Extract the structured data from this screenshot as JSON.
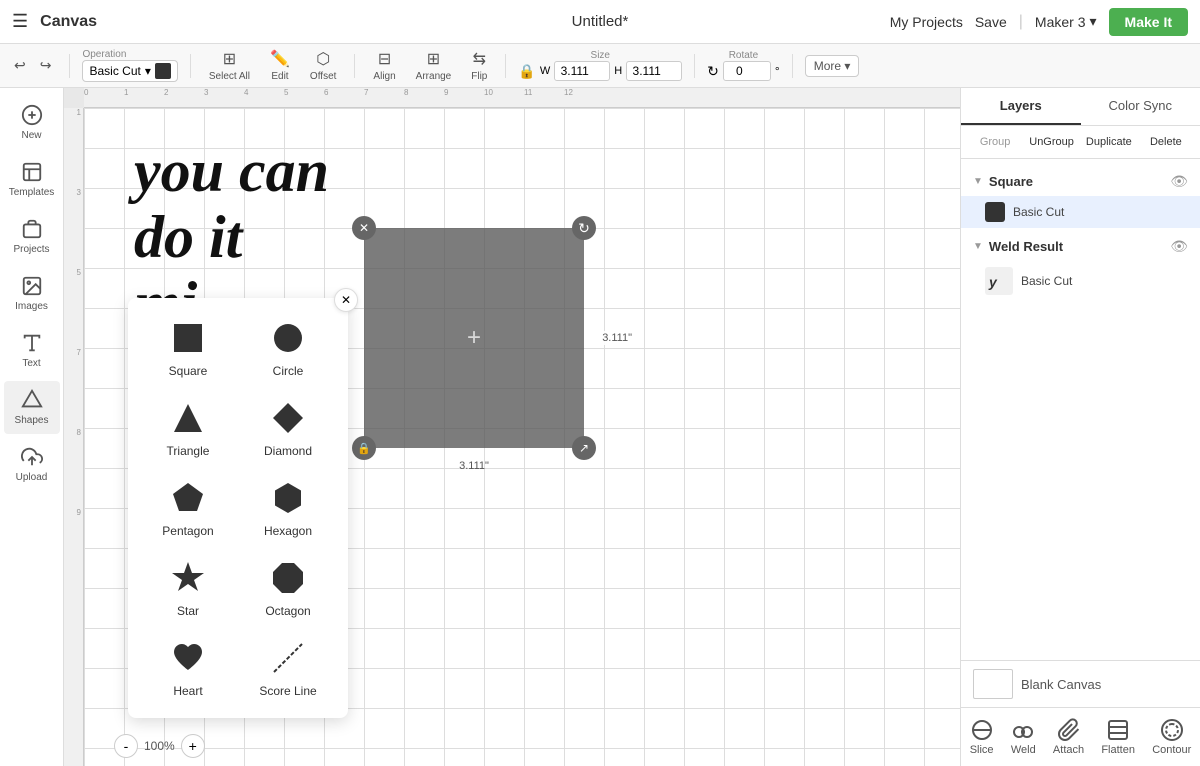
{
  "app": {
    "title": "Canvas",
    "doc_title": "Untitled*"
  },
  "topbar": {
    "my_projects": "My Projects",
    "save": "Save",
    "machine": "Maker 3",
    "make_it": "Make It"
  },
  "toolbar": {
    "operation_label": "Operation",
    "operation_value": "Basic Cut",
    "select_all": "Select All",
    "edit": "Edit",
    "offset": "Offset",
    "align": "Align",
    "arrange": "Arrange",
    "flip": "Flip",
    "size_label": "Size",
    "size_w": "3.111",
    "size_h": "3.111",
    "rotate_label": "Rotate",
    "rotate_value": "0",
    "more": "More ▾"
  },
  "sidebar": {
    "items": [
      {
        "label": "New",
        "icon": "plus"
      },
      {
        "label": "Templates",
        "icon": "templates"
      },
      {
        "label": "Projects",
        "icon": "projects"
      },
      {
        "label": "Images",
        "icon": "images"
      },
      {
        "label": "Text",
        "icon": "text"
      },
      {
        "label": "Shapes",
        "icon": "shapes"
      },
      {
        "label": "Upload",
        "icon": "upload"
      }
    ]
  },
  "shapes_panel": {
    "shapes": [
      {
        "name": "Square",
        "type": "square"
      },
      {
        "name": "Circle",
        "type": "circle"
      },
      {
        "name": "Triangle",
        "type": "triangle"
      },
      {
        "name": "Diamond",
        "type": "diamond"
      },
      {
        "name": "Pentagon",
        "type": "pentagon"
      },
      {
        "name": "Hexagon",
        "type": "hexagon"
      },
      {
        "name": "Star",
        "type": "star"
      },
      {
        "name": "Octagon",
        "type": "octagon"
      },
      {
        "name": "Heart",
        "type": "heart"
      },
      {
        "name": "Score Line",
        "type": "scoreline"
      }
    ]
  },
  "canvas": {
    "size_w": "3.111\"",
    "size_h": "3.111\"",
    "zoom": "100%"
  },
  "right_panel": {
    "tabs": [
      "Layers",
      "Color Sync"
    ],
    "active_tab": "Layers",
    "groups": [
      {
        "name": "Square",
        "items": [
          {
            "label": "Basic Cut",
            "color": "#333333"
          }
        ]
      },
      {
        "name": "Weld Result",
        "items": [
          {
            "label": "Basic Cut",
            "color": "#888888"
          }
        ]
      }
    ],
    "buttons": [
      "Group",
      "UnGroup",
      "Duplicate",
      "Delete"
    ],
    "blank_canvas_label": "Blank Canvas"
  },
  "bottom_tools": {
    "items": [
      "Slice",
      "Weld",
      "Attach",
      "Flatten",
      "Contour"
    ]
  }
}
